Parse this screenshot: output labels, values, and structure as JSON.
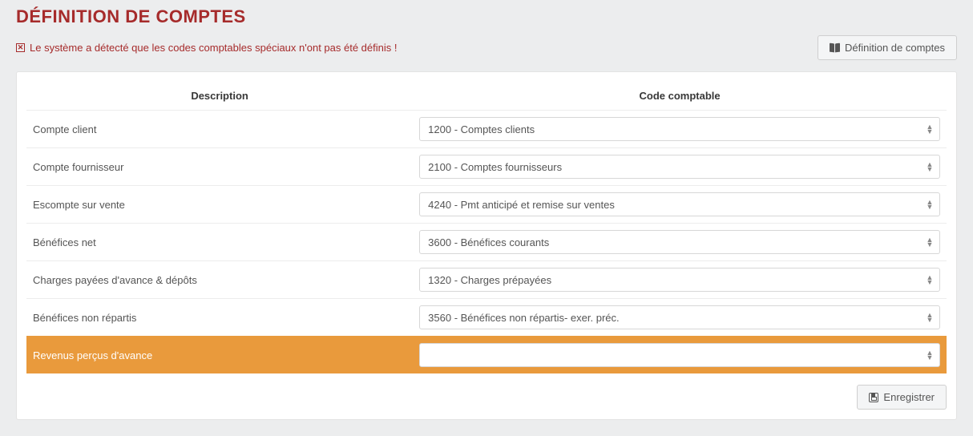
{
  "page": {
    "title": "DÉFINITION DE COMPTES"
  },
  "warning": {
    "text": "Le système a détecté que les codes comptables spéciaux n'ont pas été définis !"
  },
  "headerButton": {
    "label": "Définition de comptes"
  },
  "table": {
    "headers": {
      "description": "Description",
      "account": "Code comptable"
    },
    "rows": [
      {
        "description": "Compte client",
        "value": "1200 - Comptes clients",
        "highlight": false
      },
      {
        "description": "Compte fournisseur",
        "value": "2100 - Comptes fournisseurs",
        "highlight": false
      },
      {
        "description": "Escompte sur vente",
        "value": "4240 - Pmt anticipé et remise sur ventes",
        "highlight": false
      },
      {
        "description": "Bénéfices net",
        "value": "3600 - Bénéfices courants",
        "highlight": false
      },
      {
        "description": "Charges payées d'avance & dépôts",
        "value": "1320 - Charges prépayées",
        "highlight": false
      },
      {
        "description": "Bénéfices non répartis",
        "value": "3560 - Bénéfices non répartis- exer. préc.",
        "highlight": false
      },
      {
        "description": "Revenus perçus d'avance",
        "value": "",
        "highlight": true
      }
    ]
  },
  "footer": {
    "saveLabel": "Enregistrer"
  }
}
